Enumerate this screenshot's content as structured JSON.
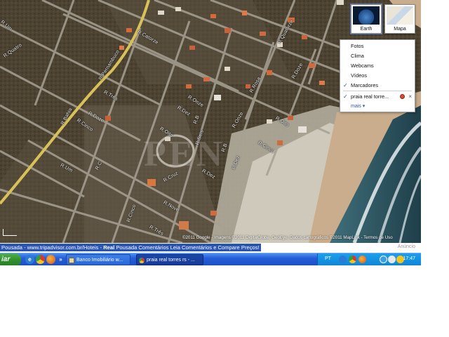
{
  "map": {
    "map_types": [
      {
        "label": "Earth",
        "active": true
      },
      {
        "label": "Mapa",
        "active": false
      }
    ],
    "layers": {
      "items": [
        {
          "label": "Fotos",
          "checked": false
        },
        {
          "label": "Clima",
          "checked": false
        },
        {
          "label": "Webcams",
          "checked": false
        },
        {
          "label": "Vídeos",
          "checked": false
        },
        {
          "label": "Marcadores",
          "checked": true
        },
        {
          "label": "praia real torre...",
          "checked": true
        }
      ],
      "more": "mais ▾",
      "remove_symbol": "×"
    },
    "street_labels": [
      "R.Quatro",
      "R.Um",
      "R.Pernambuco",
      "R.Bahia",
      "R.Cinco",
      "R.Três",
      "R.Doze",
      "R.Um",
      "R.Catorze",
      "R.Onze",
      "R.Dez",
      "R.Oito",
      "R.Cruz",
      "R.Seis",
      "R.B",
      "R.C",
      "R.Dez",
      "R.Nove",
      "R.Três",
      "R.Dez",
      "R.Cinco",
      "R.Oito",
      "R.Cinco",
      "R.Quatorze",
      "R.Doze",
      "R.Rosa",
      "R.Onze",
      "R.B"
    ],
    "watermark": "PEN",
    "copyright": "©2011 Google - Imagens ©2011 DigitalGlobe, GeoEye, Dados cartográficos ©2011 MapLink - Termos de Uso"
  },
  "ad": {
    "prefix": "Pousada - www.tripadvisor.com.br/Hoteis - ",
    "bold": "Real",
    "rest": " Pousada Comentários Leia Comentários e Compare Preços!",
    "label": "Anúncio"
  },
  "taskbar": {
    "start_label": "iar",
    "quick_launch": [
      {
        "icon": "ie-icon",
        "glyph": "e",
        "color": "#2a7ad6"
      },
      {
        "icon": "chrome-icon",
        "glyph": "",
        "color": "#d9382c"
      },
      {
        "icon": "firefox-icon",
        "glyph": "",
        "color": "#e8731c"
      },
      {
        "icon": "more-icon",
        "glyph": "»",
        "color": "#1a55c8"
      }
    ],
    "tasks": [
      {
        "label": "Banco Imobiliário     w..."
      },
      {
        "label": "praia real torres rs - ..."
      }
    ],
    "language": "PT",
    "clock": "17:47"
  }
}
